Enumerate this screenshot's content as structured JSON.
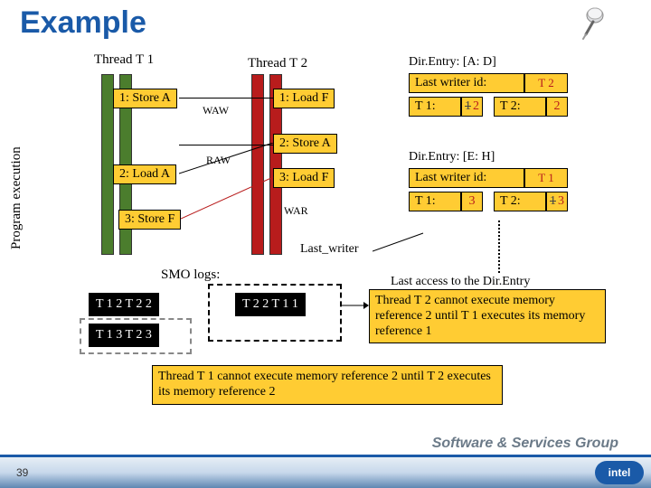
{
  "title": "Example",
  "axis_label": "Program execution",
  "threads": {
    "t1": "Thread T 1",
    "t2": "Thread T 2"
  },
  "instr": {
    "t1_1": "1: Store A",
    "t1_2": "2: Load A",
    "t1_3": "3: Store F",
    "t2_1": "1: Load F",
    "t2_2": "2: Store A",
    "t2_3": "3: Load F"
  },
  "hazards": {
    "waw": "WAW",
    "raw": "RAW",
    "war": "WAR"
  },
  "dir": {
    "a": {
      "header": "Dir.Entry: [A: D]",
      "last_writer_label": "Last writer id:",
      "last_writer_val": "T 2",
      "t1_label": "T 1:",
      "t1_val_strike": "1",
      "t1_val": "2",
      "t2_label": "T 2:",
      "t2_val": "2"
    },
    "e": {
      "header": "Dir.Entry: [E: H]",
      "last_writer_label": "Last writer id:",
      "last_writer_val": "T 1",
      "t1_label": "T 1:",
      "t1_val": "3",
      "t2_label": "T 2:",
      "t2_val_strike": "1",
      "t2_val": "3"
    }
  },
  "last_writer_label": "Last_writer",
  "smo": {
    "label": "SMO logs:",
    "box1": "T 1 2 T 2 2",
    "box2": "T 1 3 T 2 3",
    "box3": "T 2 2 T 1 1"
  },
  "notes": {
    "last_access": "Last access to the Dir.Entry",
    "t2_cannot": "Thread T 2 cannot execute memory reference 2 until T 1 executes its memory reference 1",
    "t1_cannot": "Thread T 1 cannot execute memory reference 2 until T 2 executes its memory reference 2"
  },
  "footer": {
    "group": "Software & Services Group",
    "logo": "intel",
    "page": "39"
  }
}
